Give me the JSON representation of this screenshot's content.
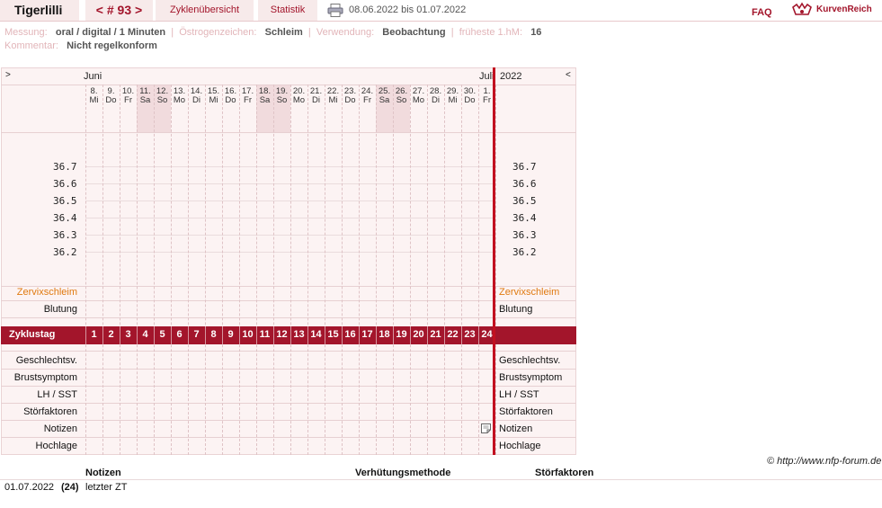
{
  "header": {
    "user": "Tigerlilli",
    "cycle_nav": "< # 93 >",
    "tab_overview": "Zyklenübersicht",
    "tab_stats": "Statistik",
    "period": "08.06.2022 bis 01.07.2022",
    "faq": "FAQ",
    "logo": "KurvenReich"
  },
  "info": {
    "messung_label": "Messung:",
    "messung_value": "oral / digital / 1 Minuten",
    "oestrogen_label": "Östrogenzeichen:",
    "oestrogen_value": "Schleim",
    "verwendung_label": "Verwendung:",
    "verwendung_value": "Beobachtung",
    "hm_label": "früheste 1.hM:",
    "hm_value": "16",
    "kommentar_label": "Kommentar:",
    "kommentar_value": "Nicht regelkonform"
  },
  "chart": {
    "nav_left": ">",
    "nav_right": "<",
    "month_start": "Juni",
    "month_end": "Juli",
    "year": "2022",
    "days": [
      {
        "d": "8.",
        "w": "Mi",
        "we": false
      },
      {
        "d": "9.",
        "w": "Do",
        "we": false
      },
      {
        "d": "10.",
        "w": "Fr",
        "we": false
      },
      {
        "d": "11.",
        "w": "Sa",
        "we": true
      },
      {
        "d": "12.",
        "w": "So",
        "we": true
      },
      {
        "d": "13.",
        "w": "Mo",
        "we": false
      },
      {
        "d": "14.",
        "w": "Di",
        "we": false
      },
      {
        "d": "15.",
        "w": "Mi",
        "we": false
      },
      {
        "d": "16.",
        "w": "Do",
        "we": false
      },
      {
        "d": "17.",
        "w": "Fr",
        "we": false
      },
      {
        "d": "18.",
        "w": "Sa",
        "we": true
      },
      {
        "d": "19.",
        "w": "So",
        "we": true
      },
      {
        "d": "20.",
        "w": "Mo",
        "we": false
      },
      {
        "d": "21.",
        "w": "Di",
        "we": false
      },
      {
        "d": "22.",
        "w": "Mi",
        "we": false
      },
      {
        "d": "23.",
        "w": "Do",
        "we": false
      },
      {
        "d": "24.",
        "w": "Fr",
        "we": false
      },
      {
        "d": "25.",
        "w": "Sa",
        "we": true
      },
      {
        "d": "26.",
        "w": "So",
        "we": true
      },
      {
        "d": "27.",
        "w": "Mo",
        "we": false
      },
      {
        "d": "28.",
        "w": "Di",
        "we": false
      },
      {
        "d": "29.",
        "w": "Mi",
        "we": false
      },
      {
        "d": "30.",
        "w": "Do",
        "we": false
      },
      {
        "d": "1.",
        "w": "Fr",
        "we": false
      }
    ],
    "temps": [
      "36.7",
      "36.6",
      "36.5",
      "36.4",
      "36.3",
      "36.2"
    ],
    "row_zervix": "Zervixschleim",
    "row_blutung": "Blutung",
    "zyklustag_label": "Zyklustag",
    "zyklustage": [
      "1",
      "2",
      "3",
      "4",
      "5",
      "6",
      "7",
      "8",
      "9",
      "10",
      "11",
      "12",
      "13",
      "14",
      "15",
      "16",
      "17",
      "18",
      "19",
      "20",
      "21",
      "22",
      "23",
      "24"
    ],
    "rows_bottom": [
      "Geschlechtsv.",
      "Brustsymptom",
      "LH / SST",
      "Störfaktoren",
      "Notizen",
      "Hochlage"
    ]
  },
  "colors": {
    "accent": "#a3152b",
    "today_line": "#c21020",
    "zervix": "#e07a10"
  },
  "footer": {
    "copyright": "© http://www.nfp-forum.de",
    "col_notizen": "Notizen",
    "col_verhuetung": "Verhütungsmethode",
    "col_stoer": "Störfaktoren",
    "entry_date": "01.07.2022",
    "entry_day": "(24)",
    "entry_note": "letzter ZT"
  }
}
